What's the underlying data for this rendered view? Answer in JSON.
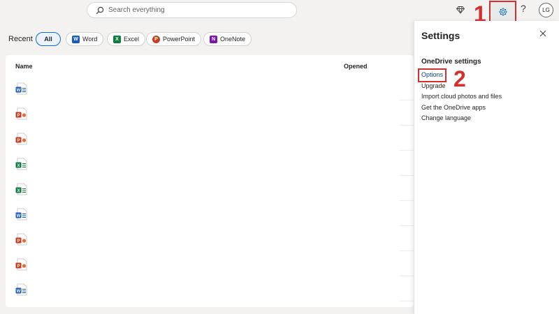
{
  "search": {
    "placeholder": "Search everything"
  },
  "header": {
    "avatar_initials": "LG",
    "help_label": "?"
  },
  "annotations": {
    "step1": "1",
    "step2": "2"
  },
  "filters": {
    "label": "Recent",
    "chips": [
      {
        "label": "All",
        "active": true
      },
      {
        "label": "Word",
        "icon": "word-icon",
        "color": "#185abd"
      },
      {
        "label": "Excel",
        "icon": "excel-icon",
        "color": "#107c41"
      },
      {
        "label": "PowerPoint",
        "icon": "powerpoint-icon",
        "color": "#c43e1c"
      },
      {
        "label": "OneNote",
        "icon": "onenote-icon",
        "color": "#7719aa"
      }
    ]
  },
  "table": {
    "columns": [
      "Name",
      "Opened"
    ],
    "rows": [
      {
        "type": "word"
      },
      {
        "type": "powerpoint"
      },
      {
        "type": "powerpoint"
      },
      {
        "type": "excel"
      },
      {
        "type": "excel"
      },
      {
        "type": "word"
      },
      {
        "type": "powerpoint"
      },
      {
        "type": "powerpoint"
      },
      {
        "type": "word"
      }
    ]
  },
  "settings": {
    "title": "Settings",
    "section_title": "OneDrive settings",
    "links": [
      "Options",
      "Upgrade",
      "Import cloud photos and files",
      "Get the OneDrive apps",
      "Change language"
    ]
  },
  "colors": {
    "accent": "#0f6cbd",
    "annotation": "#d32f2f",
    "word": "#185abd",
    "excel": "#107c41",
    "powerpoint": "#c43e1c",
    "onenote": "#7719aa"
  }
}
